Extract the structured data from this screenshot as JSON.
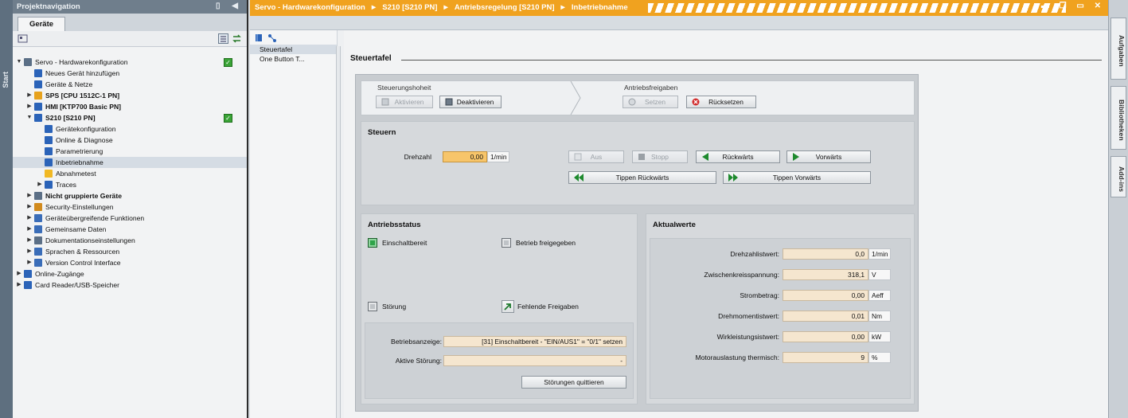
{
  "start_strip": {
    "label": "Start"
  },
  "projnav": {
    "header": "Projektnavigation",
    "tab": "Geräte",
    "tree": [
      {
        "label": "Servo - Hardwarekonfiguration",
        "level": 0,
        "arrow": "▼",
        "bold": false,
        "check": true
      },
      {
        "label": "Neues Gerät hinzufügen",
        "level": 1,
        "arrow": "",
        "bold": false
      },
      {
        "label": "Geräte & Netze",
        "level": 1,
        "arrow": "",
        "bold": false
      },
      {
        "label": "SPS [CPU 1512C-1 PN]",
        "level": 1,
        "arrow": "▶",
        "bold": true
      },
      {
        "label": "HMI [KTP700 Basic PN]",
        "level": 1,
        "arrow": "▶",
        "bold": true
      },
      {
        "label": "S210 [S210 PN]",
        "level": 1,
        "arrow": "▼",
        "bold": true,
        "check": true
      },
      {
        "label": "Gerätekonfiguration",
        "level": 2,
        "arrow": "",
        "bold": false
      },
      {
        "label": "Online & Diagnose",
        "level": 2,
        "arrow": "",
        "bold": false
      },
      {
        "label": "Parametrierung",
        "level": 2,
        "arrow": "",
        "bold": false
      },
      {
        "label": "Inbetriebnahme",
        "level": 2,
        "arrow": "",
        "bold": false,
        "selected": true
      },
      {
        "label": "Abnahmetest",
        "level": 2,
        "arrow": "",
        "bold": false
      },
      {
        "label": "Traces",
        "level": 2,
        "arrow": "▶",
        "bold": false
      },
      {
        "label": "Nicht gruppierte Geräte",
        "level": 1,
        "arrow": "▶",
        "bold": true
      },
      {
        "label": "Security-Einstellungen",
        "level": 1,
        "arrow": "▶",
        "bold": false
      },
      {
        "label": "Geräteübergreifende Funktionen",
        "level": 1,
        "arrow": "▶",
        "bold": false
      },
      {
        "label": "Gemeinsame Daten",
        "level": 1,
        "arrow": "▶",
        "bold": false
      },
      {
        "label": "Dokumentationseinstellungen",
        "level": 1,
        "arrow": "▶",
        "bold": false
      },
      {
        "label": "Sprachen & Ressourcen",
        "level": 1,
        "arrow": "▶",
        "bold": false
      },
      {
        "label": "Version Control Interface",
        "level": 1,
        "arrow": "▶",
        "bold": false
      },
      {
        "label": "Online-Zugänge",
        "level": 0,
        "arrow": "▶",
        "bold": false
      },
      {
        "label": "Card Reader/USB-Speicher",
        "level": 0,
        "arrow": "▶",
        "bold": false
      }
    ]
  },
  "breadcrumb": {
    "items": [
      "Servo - Hardwarekonfiguration",
      "S210 [S210 PN]",
      "Antriebsregelung [S210 PN]",
      "Inbetriebnahme"
    ],
    "separator": "►"
  },
  "left_nav": {
    "items": [
      "Steuertafel",
      "One Button T..."
    ]
  },
  "content": {
    "title": "Steuertafel",
    "control_band": {
      "steuerungshoheit_label": "Steuerungshoheit",
      "aktivieren": "Aktivieren",
      "deaktivieren": "Deaktivieren",
      "freigaben_label": "Antriebsfreigaben",
      "setzen": "Setzen",
      "ruecksetzen": "Rücksetzen"
    },
    "steuern": {
      "title": "Steuern",
      "drehzahl_label": "Drehzahl",
      "drehzahl_value": "0,00",
      "drehzahl_unit": "1/min",
      "aus": "Aus",
      "stopp": "Stopp",
      "rueckwaerts": "Rückwärts",
      "vorwaerts": "Vorwärts",
      "tippen_rueck": "Tippen Rückwärts",
      "tippen_vor": "Tippen Vorwärts"
    },
    "antriebsstatus": {
      "title": "Antriebsstatus",
      "einschaltbereit": "Einschaltbereit",
      "betrieb_freigegeben": "Betrieb freigegeben",
      "stoerung": "Störung",
      "fehlende_freigaben": "Fehlende Freigaben",
      "betriebsanzeige_label": "Betriebsanzeige:",
      "betriebsanzeige_value": "[31] Einschaltbereit - \"EIN/AUS1\" = \"0/1\" setzen",
      "aktive_stoerung_label": "Aktive Störung:",
      "aktive_stoerung_value": "-",
      "quittieren": "Störungen quittieren"
    },
    "aktualwerte": {
      "title": "Aktualwerte",
      "rows": [
        {
          "label": "Drehzahlistwert:",
          "value": "0,0",
          "unit": "1/min"
        },
        {
          "label": "Zwischenkreisspannung:",
          "value": "318,1",
          "unit": "V"
        },
        {
          "label": "Strombetrag:",
          "value": "0,00",
          "unit": "Aeff"
        },
        {
          "label": "Drehmomentistwert:",
          "value": "0,01",
          "unit": "Nm"
        },
        {
          "label": "Wirkleistungsistwert:",
          "value": "0,00",
          "unit": "kW"
        },
        {
          "label": "Motorauslastung thermisch:",
          "value": "9",
          "unit": "%"
        }
      ]
    }
  },
  "right_tabs": [
    "Aufgaben",
    "Bibliotheken",
    "Add-ins"
  ],
  "colors": {
    "accent_orange": "#f0a21f",
    "led_green": "#2fa34a",
    "field_orange": "#f7c56a"
  }
}
